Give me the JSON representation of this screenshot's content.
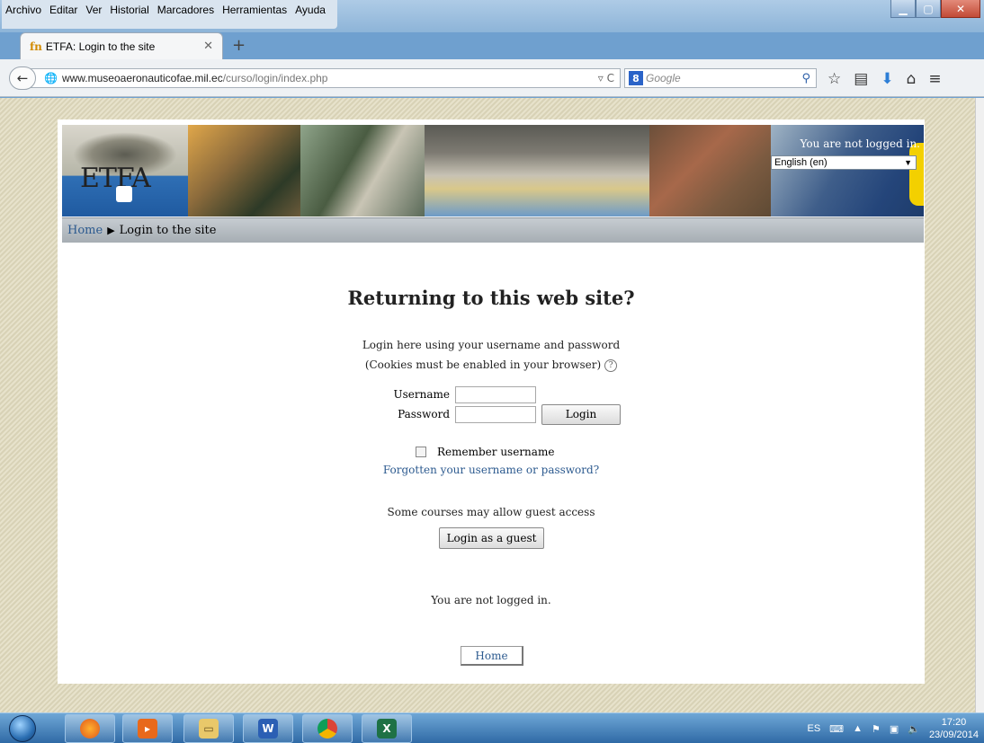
{
  "browser": {
    "menu": [
      "Archivo",
      "Editar",
      "Ver",
      "Historial",
      "Marcadores",
      "Herramientas",
      "Ayuda"
    ],
    "tab_title": "ETFA: Login to the site",
    "tab_favicon": "fn",
    "url_domain": "www.museoaeronauticofae.mil.ec",
    "url_path": "/curso/login/index.php",
    "search_placeholder": "Google",
    "search_engine_letter": "8"
  },
  "site": {
    "logo_text": "ETFA",
    "login_info": "You are not logged in.",
    "language": "English (en)",
    "breadcrumb_home": "Home",
    "breadcrumb_current": "Login to the site"
  },
  "login": {
    "heading": "Returning to this web site?",
    "intro_line1": "Login here using your username and password",
    "intro_line2": "(Cookies must be enabled in your browser)",
    "help_glyph": "?",
    "username_label": "Username",
    "password_label": "Password",
    "login_button": "Login",
    "remember_label": "Remember username",
    "forgot_link": "Forgotten your username or password?",
    "guest_info": "Some courses may allow guest access",
    "guest_button": "Login as a guest",
    "footer_status": "You are not logged in.",
    "footer_home": "Home"
  },
  "taskbar": {
    "language": "ES",
    "time": "17:20",
    "date": "23/09/2014"
  }
}
